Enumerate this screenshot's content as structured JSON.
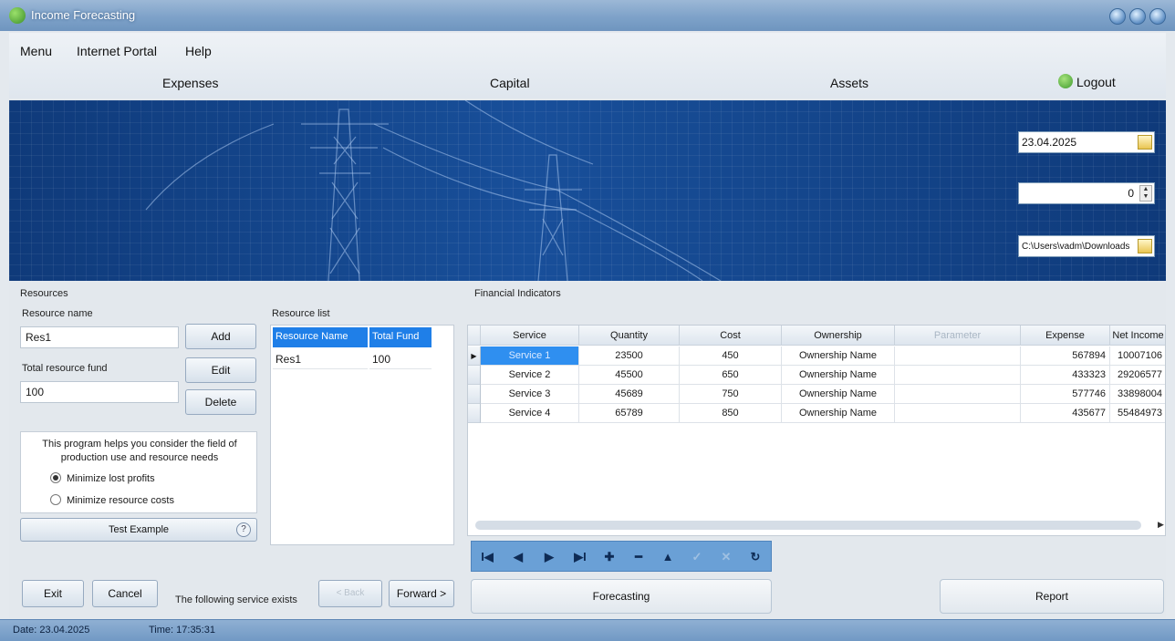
{
  "window": {
    "title": "Income Forecasting",
    "controls": [
      "minimize",
      "maximize",
      "close"
    ]
  },
  "menu": {
    "items": [
      "Menu",
      "Internet Portal",
      "Help"
    ]
  },
  "tabs": [
    "Expenses",
    "Capital",
    "Assets"
  ],
  "logout_label": "Logout",
  "banner": {
    "date_value": "23.04.2025",
    "number_value": "0",
    "path_value": "C:\\Users\\vadm\\Downloads"
  },
  "resources": {
    "group_title": "Resources",
    "name_label": "Resource name",
    "name_value": "Res1",
    "fund_label": "Total resource fund",
    "fund_value": "100",
    "add_label": "Add",
    "edit_label": "Edit",
    "delete_label": "Delete",
    "list_title": "Resource list",
    "list_headers": [
      "Resource Name",
      "Total Fund"
    ],
    "list_rows": [
      [
        "Res1",
        "100"
      ]
    ],
    "info_text": "This program helps you consider the field of production use and resource needs",
    "option_1": "Minimize lost profits",
    "option_2": "Minimize resource costs",
    "test_example_label": "Test Example",
    "help_glyph": "?"
  },
  "financial": {
    "group_title": "Financial Indicators",
    "headers": [
      "Service",
      "Quantity",
      "Cost",
      "Ownership",
      "Parameter",
      "Expense",
      "Net Income"
    ],
    "rows": [
      [
        "Service 1",
        "23500",
        "450",
        "Ownership Name",
        "",
        "567894",
        "10007106"
      ],
      [
        "Service 2",
        "45500",
        "650",
        "Ownership Name",
        "",
        "433323",
        "29206577"
      ],
      [
        "Service 3",
        "45689",
        "750",
        "Ownership Name",
        "",
        "577746",
        "33898004"
      ],
      [
        "Service 4",
        "65789",
        "850",
        "Ownership Name",
        "",
        "435677",
        "55484973"
      ]
    ]
  },
  "navigator": [
    "I◀",
    "◀",
    "▶",
    "▶I",
    "✚",
    "━",
    "▲",
    "✓",
    "✕",
    "↻"
  ],
  "bottom": {
    "exit_label": "Exit",
    "cancel_label": "Cancel",
    "service_exists_text": "The following service exists",
    "back_label": "< Back",
    "forward_label": "Forward >",
    "forecasting_label": "Forecasting",
    "report_label": "Report"
  },
  "status": {
    "date": "Date: 23.04.2025",
    "time": "Time: 17:35:31"
  },
  "colors": {
    "banner": "#184f9a",
    "selection": "#1f7fe8",
    "navigator": "#6aa0d6",
    "statusbar": "#7f9fcb"
  }
}
